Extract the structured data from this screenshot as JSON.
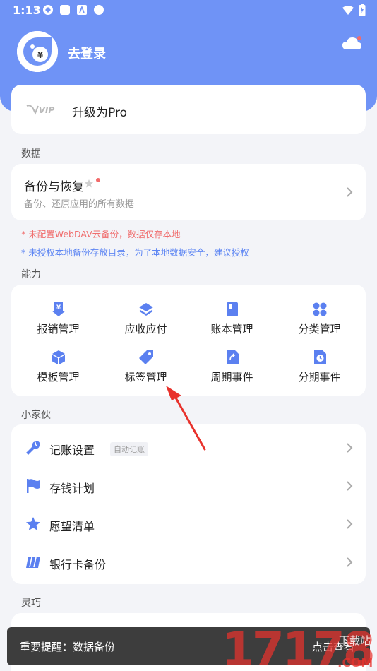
{
  "status_bar": {
    "time": "1:13"
  },
  "profile": {
    "login_label": "去登录"
  },
  "pro": {
    "badge_text": "VIP",
    "label": "升级为Pro"
  },
  "sections": {
    "data": "数据",
    "abilities": "能力",
    "tools": "小家伙",
    "smart": "灵巧"
  },
  "backup": {
    "title": "备份与恢复",
    "subtitle": "备份、还原应用的所有数据"
  },
  "warnings": {
    "red": "* 未配置WebDAV云备份，数据仅存本地",
    "blue": "* 未授权本地备份存放目录，为了本地数据安全，建议授权"
  },
  "abilities": [
    {
      "label": "报销管理",
      "icon": "reimburse-icon"
    },
    {
      "label": "应收应付",
      "icon": "layers-icon"
    },
    {
      "label": "账本管理",
      "icon": "book-icon"
    },
    {
      "label": "分类管理",
      "icon": "grid-icon"
    },
    {
      "label": "模板管理",
      "icon": "cube-icon"
    },
    {
      "label": "标签管理",
      "icon": "tag-icon"
    },
    {
      "label": "周期事件",
      "icon": "cycle-icon"
    },
    {
      "label": "分期事件",
      "icon": "installment-icon"
    }
  ],
  "tools": [
    {
      "label": "记账设置",
      "badge": "自动记账",
      "icon": "wrench-icon"
    },
    {
      "label": "存钱计划",
      "icon": "flag-icon"
    },
    {
      "label": "愿望清单",
      "icon": "star-icon"
    },
    {
      "label": "银行卡备份",
      "icon": "bank-card-icon"
    }
  ],
  "toast": {
    "message": "重要提醒：数据备份",
    "action": "点击查看"
  },
  "watermark": {
    "text": "17178",
    "sub_top": "下载站",
    "sub_bottom": ".COM"
  },
  "colors": {
    "accent": "#6f93f6",
    "icon_blue": "#5b80f0",
    "warning_red": "#f06d6d",
    "warning_blue": "#5e86f3",
    "arrow_red": "#e8322c"
  }
}
